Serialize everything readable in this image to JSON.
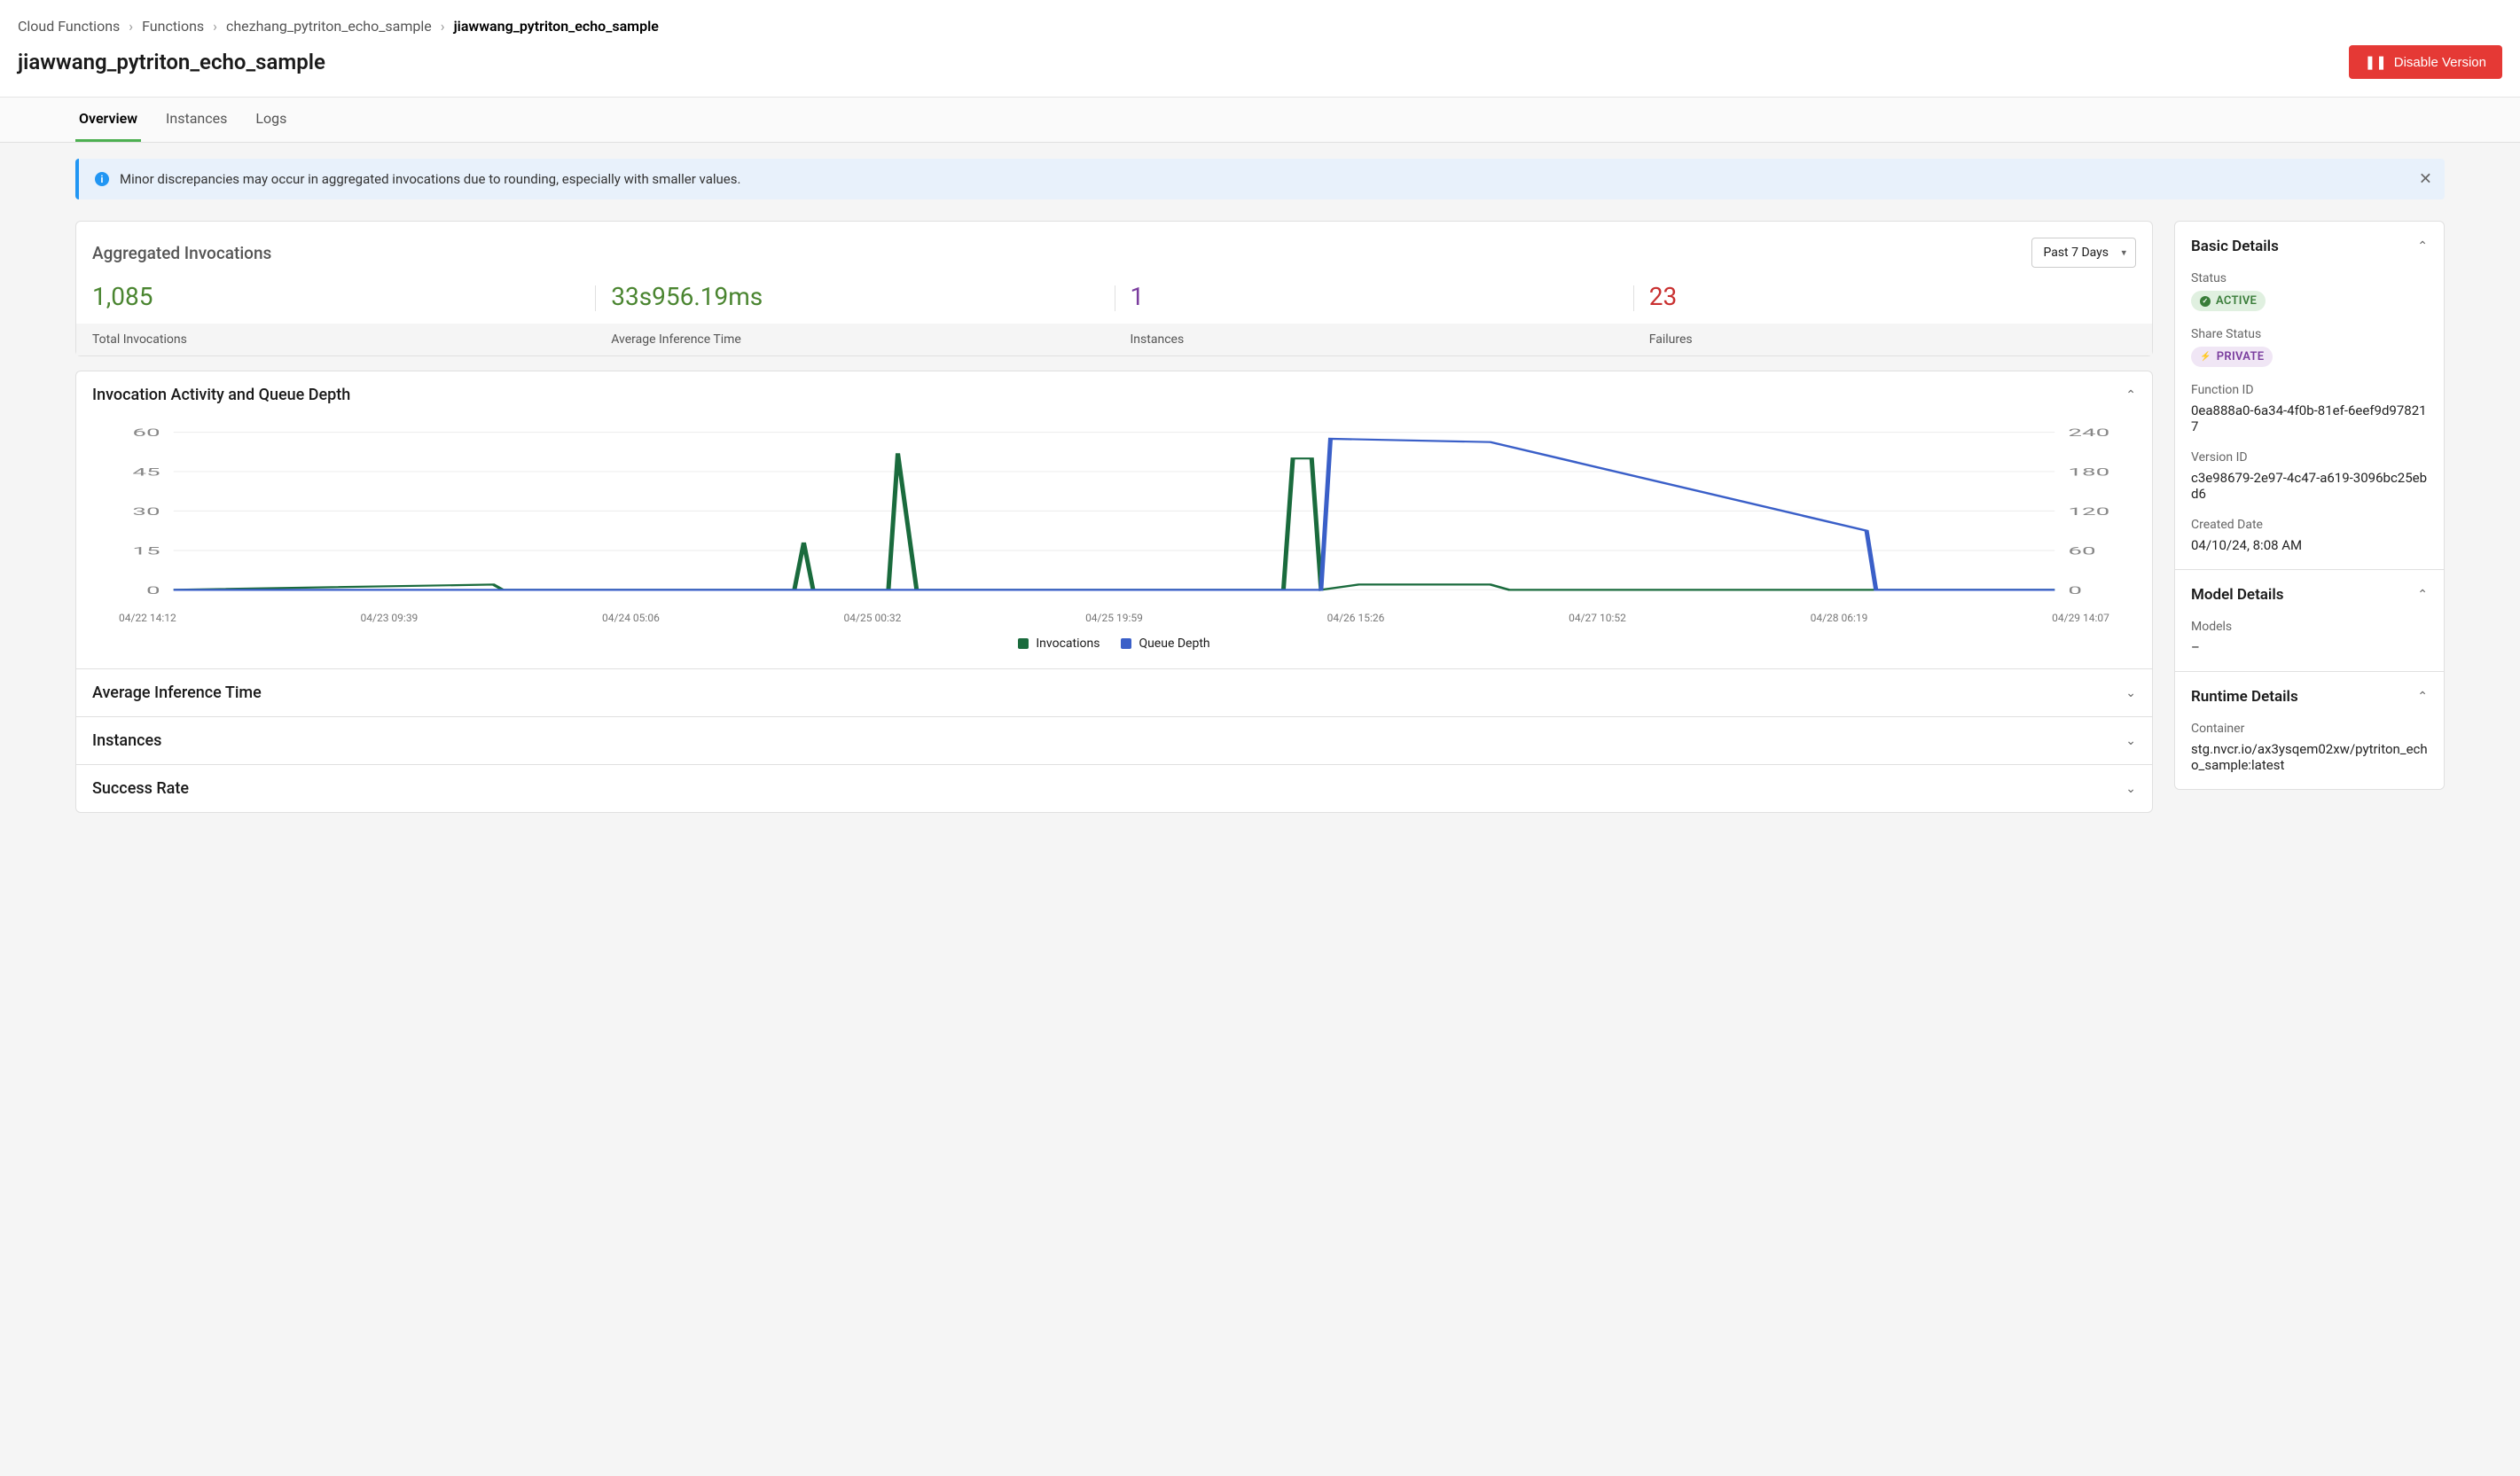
{
  "breadcrumb": {
    "items": [
      "Cloud Functions",
      "Functions",
      "chezhang_pytriton_echo_sample"
    ],
    "current": "jiawwang_pytriton_echo_sample"
  },
  "page_title": "jiawwang_pytriton_echo_sample",
  "disable_button": "Disable Version",
  "tabs": {
    "overview": "Overview",
    "instances": "Instances",
    "logs": "Logs"
  },
  "notice": "Minor discrepancies may occur in aggregated invocations due to rounding, especially with smaller values.",
  "aggregated": {
    "title": "Aggregated Invocations",
    "time_range": "Past 7 Days",
    "stats": {
      "total_invocations": {
        "value": "1,085",
        "label": "Total Invocations"
      },
      "avg_inference": {
        "value": "33s956.19ms",
        "label": "Average Inference Time"
      },
      "instances": {
        "value": "1",
        "label": "Instances"
      },
      "failures": {
        "value": "23",
        "label": "Failures"
      }
    }
  },
  "panels": {
    "activity": "Invocation Activity and Queue Depth",
    "avg_inference": "Average Inference Time",
    "instances": "Instances",
    "success_rate": "Success Rate"
  },
  "chart_data": {
    "type": "line",
    "title": "Invocation Activity and Queue Depth",
    "x_labels": [
      "04/22 14:12",
      "04/23 09:39",
      "04/24 05:06",
      "04/25 00:32",
      "04/25 19:59",
      "04/26 15:26",
      "04/27 10:52",
      "04/28 06:19",
      "04/29 14:07"
    ],
    "left_axis": {
      "label": "Invocations",
      "ticks": [
        0,
        15,
        30,
        45,
        60
      ]
    },
    "right_axis": {
      "label": "Queue Depth",
      "ticks": [
        0,
        60,
        120,
        180,
        240
      ]
    },
    "series": [
      {
        "name": "Invocations",
        "axis": "left",
        "color": "#1a6b3d",
        "points": [
          {
            "x": 0.0,
            "y": 0
          },
          {
            "x": 0.17,
            "y": 2
          },
          {
            "x": 0.175,
            "y": 0
          },
          {
            "x": 0.33,
            "y": 0
          },
          {
            "x": 0.335,
            "y": 18
          },
          {
            "x": 0.34,
            "y": 0
          },
          {
            "x": 0.38,
            "y": 0
          },
          {
            "x": 0.385,
            "y": 52
          },
          {
            "x": 0.395,
            "y": 0
          },
          {
            "x": 0.59,
            "y": 0
          },
          {
            "x": 0.595,
            "y": 50
          },
          {
            "x": 0.605,
            "y": 50
          },
          {
            "x": 0.61,
            "y": 0
          },
          {
            "x": 0.63,
            "y": 2
          },
          {
            "x": 0.7,
            "y": 2
          },
          {
            "x": 0.71,
            "y": 0
          },
          {
            "x": 1.0,
            "y": 0
          }
        ]
      },
      {
        "name": "Queue Depth",
        "axis": "right",
        "color": "#3a5fc8",
        "points": [
          {
            "x": 0.0,
            "y": 0
          },
          {
            "x": 0.61,
            "y": 0
          },
          {
            "x": 0.615,
            "y": 230
          },
          {
            "x": 0.7,
            "y": 225
          },
          {
            "x": 0.9,
            "y": 90
          },
          {
            "x": 0.905,
            "y": 0
          },
          {
            "x": 1.0,
            "y": 0
          }
        ]
      }
    ],
    "legend": {
      "invocations": "Invocations",
      "queue_depth": "Queue Depth"
    }
  },
  "basic_details": {
    "title": "Basic Details",
    "status": {
      "label": "Status",
      "value": "ACTIVE"
    },
    "share_status": {
      "label": "Share Status",
      "value": "PRIVATE"
    },
    "function_id": {
      "label": "Function ID",
      "value": "0ea888a0-6a34-4f0b-81ef-6eef9d978217"
    },
    "version_id": {
      "label": "Version ID",
      "value": "c3e98679-2e97-4c47-a619-3096bc25ebd6"
    },
    "created_date": {
      "label": "Created Date",
      "value": "04/10/24, 8:08 AM"
    }
  },
  "model_details": {
    "title": "Model Details",
    "models": {
      "label": "Models",
      "value": "–"
    }
  },
  "runtime_details": {
    "title": "Runtime Details",
    "container": {
      "label": "Container",
      "value": "stg.nvcr.io/ax3ysqem02xw/pytriton_echo_sample:latest"
    }
  }
}
